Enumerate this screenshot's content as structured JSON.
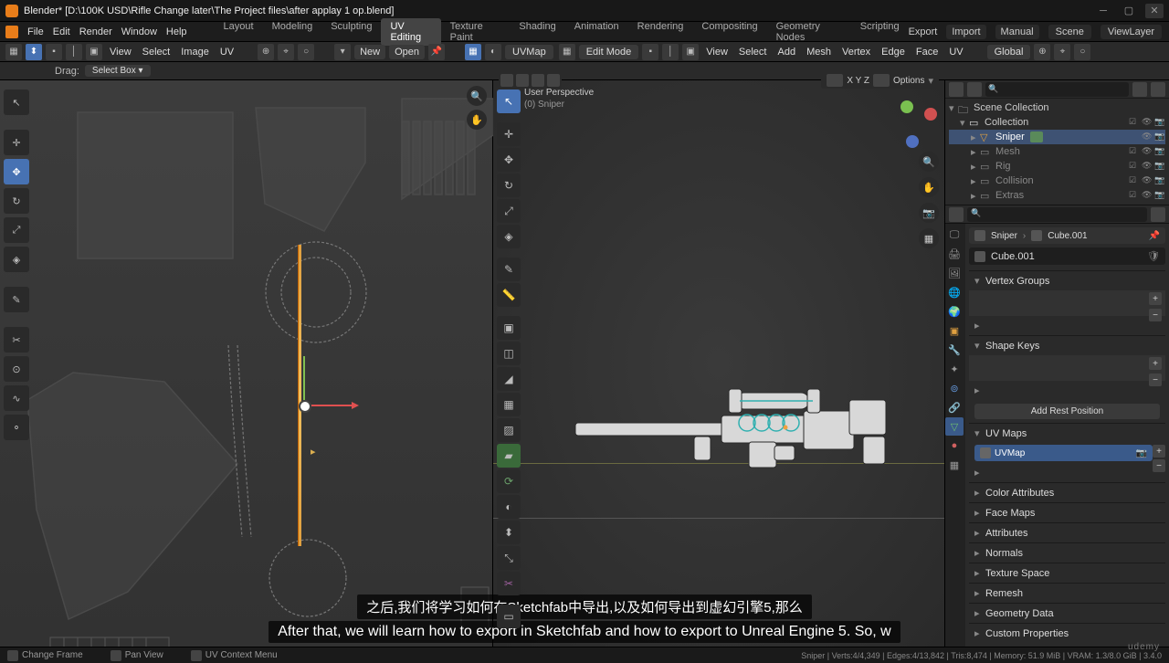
{
  "window": {
    "title": "Blender* [D:\\100K USD\\Rifle Change later\\The Project files\\after applay 1 op.blend]"
  },
  "menu": {
    "file": "File",
    "edit": "Edit",
    "render": "Render",
    "window": "Window",
    "help": "Help",
    "export": "Export",
    "import": "Import",
    "manual": "Manual",
    "scene_label": "Scene",
    "layer_label": "ViewLayer"
  },
  "workspaces": [
    "Layout",
    "Modeling",
    "Sculpting",
    "UV Editing",
    "Texture Paint",
    "Shading",
    "Animation",
    "Rendering",
    "Compositing",
    "Geometry Nodes",
    "Scripting"
  ],
  "workspace_active": 3,
  "uvbar": {
    "view": "View",
    "select": "Select",
    "image": "Image",
    "uv": "UV",
    "sync": "UV Sync",
    "new": "New",
    "open": "Open",
    "uvmap": "UVMap"
  },
  "uvheader2": {
    "drag": "Drag:",
    "mode": "Select Box"
  },
  "vpbar": {
    "mode": "Edit Mode",
    "view": "View",
    "select": "Select",
    "add": "Add",
    "mesh": "Mesh",
    "vertex": "Vertex",
    "edge": "Edge",
    "face": "Face",
    "uv": "UV",
    "orient": "Global"
  },
  "vp3d": {
    "persp": "User Perspective",
    "obj": "(0) Sniper",
    "options": "Options"
  },
  "outliner": {
    "root": "Scene Collection",
    "collection": "Collection",
    "items": [
      {
        "name": "Sniper",
        "sel": true,
        "badge": true,
        "dim": false
      },
      {
        "name": "Mesh",
        "sel": false,
        "dim": true
      },
      {
        "name": "Rig",
        "sel": false,
        "dim": true
      },
      {
        "name": "Collision",
        "sel": false,
        "dim": true
      },
      {
        "name": "Extras",
        "sel": false,
        "dim": true
      }
    ]
  },
  "props": {
    "crumb_obj": "Sniper",
    "crumb_data": "Cube.001",
    "name": "Cube.001",
    "panels": {
      "vg": "Vertex Groups",
      "sk": "Shape Keys",
      "rest": "Add Rest Position",
      "uvmaps": "UV Maps",
      "uvmap_item": "UVMap",
      "colattr": "Color Attributes",
      "facemaps": "Face Maps",
      "attrs": "Attributes",
      "normals": "Normals",
      "texspace": "Texture Space",
      "remesh": "Remesh",
      "geodata": "Geometry Data",
      "custom": "Custom Properties"
    }
  },
  "status": {
    "left1": "Change Frame",
    "left2": "Pan View",
    "left3": "UV Context Menu",
    "right": "Sniper | Verts:4/4,349 | Edges:4/13,842 | Tris:8,474 | Memory: 51.9 MiB | VRAM: 1.3/8.0 GiB | 3.4.0"
  },
  "subtitles": {
    "cn": "之后,我们将学习如何在Sketchfab中导出,以及如何导出到虚幻引擎5,那么",
    "en": "After that, we will learn how to export in Sketchfab and how to export to Unreal Engine 5. So, w"
  },
  "branding": {
    "udemy": "udemy"
  }
}
